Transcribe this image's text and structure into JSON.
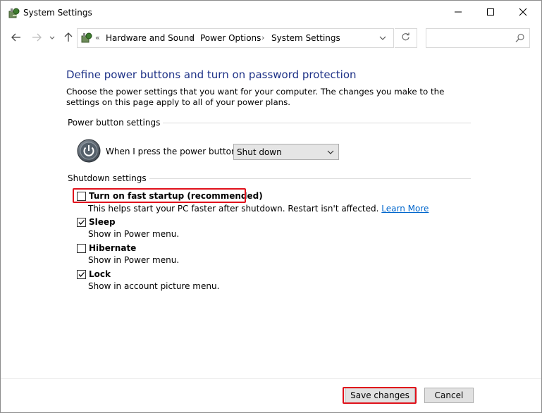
{
  "window": {
    "title": "System Settings",
    "icons": {
      "app": "power-options-icon",
      "minimize": "minimize-icon",
      "maximize": "maximize-icon",
      "close": "close-icon"
    }
  },
  "nav": {
    "back_icon": "arrow-left-icon",
    "forward_icon": "arrow-right-icon",
    "recent_icon": "chevron-down-icon",
    "up_icon": "arrow-up-icon",
    "breadcrumb": {
      "overflow": "«",
      "items": [
        "Hardware and Sound",
        "Power Options",
        "System Settings"
      ],
      "separator": "›"
    },
    "refresh_icon": "refresh-icon",
    "search_placeholder": "",
    "search_icon": "search-icon"
  },
  "page": {
    "heading": "Define power buttons and turn on password protection",
    "description": "Choose the power settings that you want for your computer. The changes you make to the settings on this page apply to all of your power plans.",
    "power_section": {
      "title": "Power button settings",
      "label": "When I press the power button:",
      "selected": "Shut down"
    },
    "shutdown_section": {
      "title": "Shutdown settings",
      "options": [
        {
          "label": "Turn on fast startup (recommended)",
          "checked": false,
          "desc": "This helps start your PC faster after shutdown. Restart isn't affected.",
          "link": "Learn More"
        },
        {
          "label": "Sleep",
          "checked": true,
          "desc": "Show in Power menu."
        },
        {
          "label": "Hibernate",
          "checked": false,
          "desc": "Show in Power menu."
        },
        {
          "label": "Lock",
          "checked": true,
          "desc": "Show in account picture menu."
        }
      ]
    }
  },
  "footer": {
    "save_label": "Save changes",
    "cancel_label": "Cancel"
  },
  "colors": {
    "heading": "#1e3287",
    "link": "#0066cc",
    "highlight": "#e0111b"
  }
}
